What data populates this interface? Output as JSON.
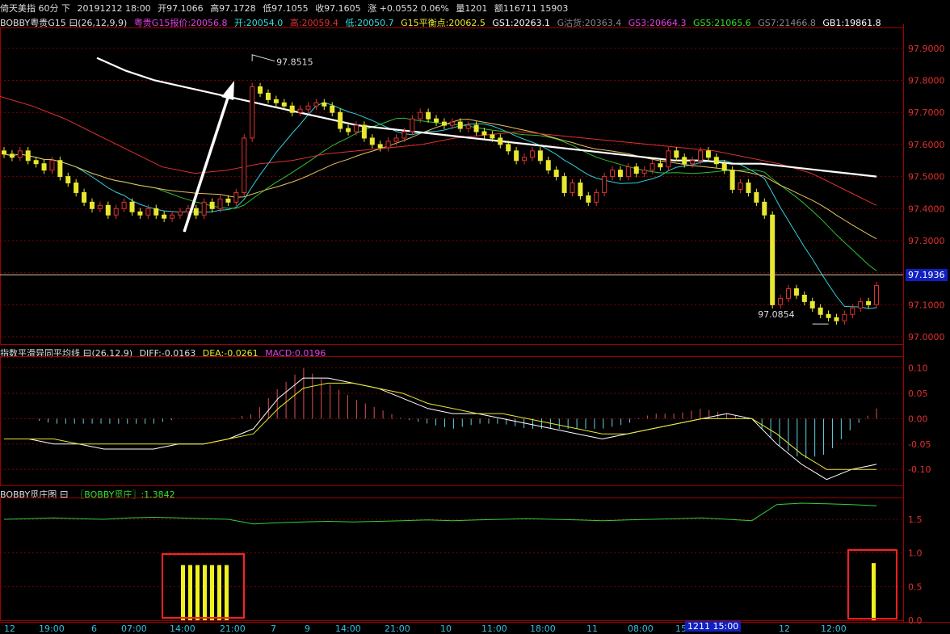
{
  "top_bar": {
    "title": "倚天美指 60分 下",
    "datetime": "20191212 18:00",
    "open": "开97.1066",
    "high": "高97.1728",
    "low": "低97.1055",
    "close": "收97.1605",
    "change": "涨 +0.0552 0.06%",
    "volume": "量1201",
    "amount": "额116711 15903"
  },
  "main_legend": {
    "name": "BOBBY粤贵G15 曰(26,12,9,9)",
    "items": [
      {
        "text": "粤贵G15报价:20056.8",
        "color": "#e040e0"
      },
      {
        "text": "开:20054.0",
        "color": "#30e0e0"
      },
      {
        "text": "高:20059.4",
        "color": "#e03030"
      },
      {
        "text": "低:20050.7",
        "color": "#30e0e0"
      },
      {
        "text": "G15平衡点:20062.5",
        "color": "#e8e830"
      },
      {
        "text": "GS1:20263.1",
        "color": "#ffffff"
      },
      {
        "text": "G沽货:20363.4",
        "color": "#888888"
      },
      {
        "text": "GS3:20664.3",
        "color": "#e040e0"
      },
      {
        "text": "GS5:21065.6",
        "color": "#30e030"
      },
      {
        "text": "GS7:21466.8",
        "color": "#888888"
      },
      {
        "text": "GB1:19861.8",
        "color": "#ffffff"
      }
    ]
  },
  "macd_legend": {
    "name": "指数平滑异同平均线 曰(26,12,9)",
    "diff": "DIFF:-0.0163",
    "dea": "DEA:-0.0261",
    "macd": "MACD:0.0196"
  },
  "bobby_legend": {
    "name": "BOBBY觅庄图 曰",
    "value": "〖BOBBY觅庄〗:1.3842"
  },
  "annotations": {
    "high_label": "97.8515",
    "low_label": "97.0854",
    "current_price": "97.1936",
    "time_badge": "1211 15:00"
  },
  "colors": {
    "up": "#e03030",
    "down": "#e8e830",
    "ma_white": "#ffffff",
    "ma_red": "#e03030",
    "ma_orange": "#e8c060",
    "ma_green": "#30c030",
    "ma_cyan": "#30d0e0",
    "grid": "#800000",
    "axis_text": "#e03030"
  },
  "chart_data": [
    {
      "type": "candlestick",
      "title": "倚天美指 60分",
      "ylim": [
        96.98,
        97.96
      ],
      "y_ticks": [
        "97.9000",
        "97.8000",
        "97.7000",
        "97.6000",
        "97.5000",
        "97.4000",
        "97.3000",
        "97.2000",
        "97.1000",
        "97.0000"
      ],
      "x_ticks": [
        "12",
        "19:00",
        "6",
        "07:00",
        "14:00",
        "21:00",
        "7",
        "9",
        "14:00",
        "21:00",
        "10",
        "11:00",
        "18:00",
        "11",
        "08:00",
        "15",
        "12",
        "12:00"
      ],
      "close_series": [
        97.57,
        97.56,
        97.58,
        97.55,
        97.54,
        97.52,
        97.55,
        97.5,
        97.48,
        97.45,
        97.42,
        97.4,
        97.41,
        97.38,
        97.4,
        97.42,
        97.39,
        97.38,
        97.4,
        97.38,
        97.37,
        97.38,
        97.39,
        97.4,
        97.38,
        97.42,
        97.4,
        97.43,
        97.42,
        97.45,
        97.62,
        97.78,
        97.76,
        97.74,
        97.73,
        97.72,
        97.7,
        97.71,
        97.72,
        97.73,
        97.72,
        97.7,
        97.65,
        97.64,
        97.66,
        97.62,
        97.6,
        97.59,
        97.61,
        97.62,
        97.64,
        97.68,
        97.7,
        97.68,
        97.67,
        97.66,
        97.67,
        97.65,
        97.66,
        97.64,
        97.63,
        97.62,
        97.6,
        97.58,
        97.55,
        97.56,
        97.58,
        97.55,
        97.52,
        97.5,
        97.45,
        97.48,
        97.44,
        97.42,
        97.45,
        97.5,
        97.52,
        97.5,
        97.53,
        97.51,
        97.52,
        97.54,
        97.53,
        97.58,
        97.56,
        97.54,
        97.55,
        97.58,
        97.56,
        97.54,
        97.52,
        97.46,
        97.48,
        97.45,
        97.42,
        97.38,
        97.1,
        97.12,
        97.15,
        97.13,
        97.11,
        97.09,
        97.07,
        97.06,
        97.05,
        97.07,
        97.09,
        97.11,
        97.1,
        97.16
      ],
      "series": [
        {
          "name": "GS1",
          "values": [
            97.87,
            97.83,
            97.8,
            97.78,
            97.76,
            97.74,
            97.72,
            97.7,
            97.68,
            97.66,
            97.65,
            97.64,
            97.63,
            97.62,
            97.61,
            97.6,
            97.59,
            97.58,
            97.57,
            97.56,
            97.55,
            97.55,
            97.54,
            97.54,
            97.53,
            97.52,
            97.51,
            97.5
          ]
        },
        {
          "name": "MA-red",
          "values": [
            97.75,
            97.72,
            97.68,
            97.63,
            97.58,
            97.53,
            97.51,
            97.52,
            97.54,
            97.55,
            97.57,
            97.58,
            97.59,
            97.6,
            97.62,
            97.63,
            97.64,
            97.63,
            97.62,
            97.61,
            97.6,
            97.59,
            97.58,
            97.56,
            97.54,
            97.51,
            97.46,
            97.41
          ]
        }
      ]
    },
    {
      "type": "bar",
      "title": "指数平滑异同平均线",
      "ylim": [
        -0.13,
        0.12
      ],
      "y_ticks": [
        "0.10",
        "0.05",
        "0.00",
        "-0.05",
        "-0.10"
      ],
      "series": [
        {
          "name": "DIFF",
          "values": [
            -0.04,
            -0.04,
            -0.05,
            -0.05,
            -0.06,
            -0.06,
            -0.06,
            -0.05,
            -0.05,
            -0.04,
            -0.02,
            0.04,
            0.08,
            0.08,
            0.07,
            0.06,
            0.04,
            0.02,
            0.01,
            0.01,
            0.0,
            -0.01,
            -0.02,
            -0.03,
            -0.04,
            -0.03,
            -0.02,
            -0.01,
            0.0,
            0.01,
            0.0,
            -0.05,
            -0.09,
            -0.12,
            -0.1,
            -0.09
          ]
        },
        {
          "name": "DEA",
          "values": [
            -0.04,
            -0.04,
            -0.04,
            -0.05,
            -0.05,
            -0.05,
            -0.05,
            -0.05,
            -0.05,
            -0.04,
            -0.03,
            0.02,
            0.06,
            0.07,
            0.07,
            0.06,
            0.05,
            0.03,
            0.02,
            0.01,
            0.01,
            0.0,
            -0.01,
            -0.02,
            -0.03,
            -0.03,
            -0.02,
            -0.01,
            0.0,
            0.0,
            0.0,
            -0.03,
            -0.07,
            -0.1,
            -0.1,
            -0.1
          ]
        },
        {
          "name": "MACD",
          "values": [
            0.0,
            0.0,
            -0.01,
            -0.01,
            -0.01,
            -0.01,
            -0.01,
            0.0,
            0.0,
            0.0,
            0.01,
            0.06,
            0.1,
            0.07,
            0.04,
            0.02,
            0.0,
            -0.01,
            -0.02,
            -0.01,
            -0.01,
            -0.02,
            -0.02,
            -0.02,
            -0.02,
            -0.01,
            0.01,
            0.01,
            0.02,
            0.01,
            0.0,
            -0.05,
            -0.08,
            -0.07,
            -0.02,
            0.02
          ]
        }
      ]
    },
    {
      "type": "bar",
      "title": "BOBBY觅庄图",
      "ylim": [
        0.0,
        1.8
      ],
      "y_ticks": [
        "1.5",
        "1.0",
        "0.5",
        "0.0"
      ],
      "series": [
        {
          "name": "BOBBY觅庄",
          "values": [
            1.5,
            1.51,
            1.52,
            1.51,
            1.5,
            1.52,
            1.53,
            1.52,
            1.51,
            1.5,
            1.43,
            1.45,
            1.46,
            1.47,
            1.46,
            1.47,
            1.48,
            1.49,
            1.48,
            1.49,
            1.5,
            1.51,
            1.5,
            1.49,
            1.48,
            1.49,
            1.5,
            1.51,
            1.52,
            1.5,
            1.48,
            1.72,
            1.74,
            1.73,
            1.72,
            1.7
          ]
        },
        {
          "name": "signal-bars",
          "values": [
            0.82,
            0.82,
            0.82,
            0.82,
            0.82,
            0.82,
            0.82,
            0.85
          ]
        }
      ]
    }
  ]
}
